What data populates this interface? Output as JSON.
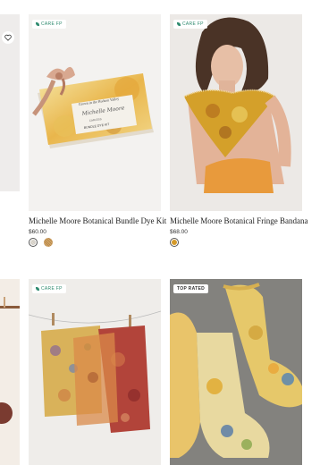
{
  "products": [
    {
      "badge": "CARE FP",
      "title": "Michelle Moore Botanical Bundle Dye Kit",
      "price": "$60.00",
      "box_text": [
        "Grown in the Hudson Valley",
        "Michelle Moore",
        "CARLESS",
        "BUNDLE DYE KIT"
      ],
      "swatches": [
        {
          "color": "#d9d4cc",
          "selected": true
        },
        {
          "color": "#c79a5a",
          "selected": false
        }
      ]
    },
    {
      "badge": "CARE FP",
      "title": "Michelle Moore Botanical Fringe Bandana",
      "price": "$68.00",
      "swatches": [
        {
          "color": "#d49a2a",
          "selected": true
        }
      ]
    },
    {
      "badge": "CARE FP"
    },
    {
      "badge": "TOP RATED"
    }
  ],
  "icons": {
    "wishlist": "heart-icon",
    "care_badge": "leaf-icon"
  }
}
